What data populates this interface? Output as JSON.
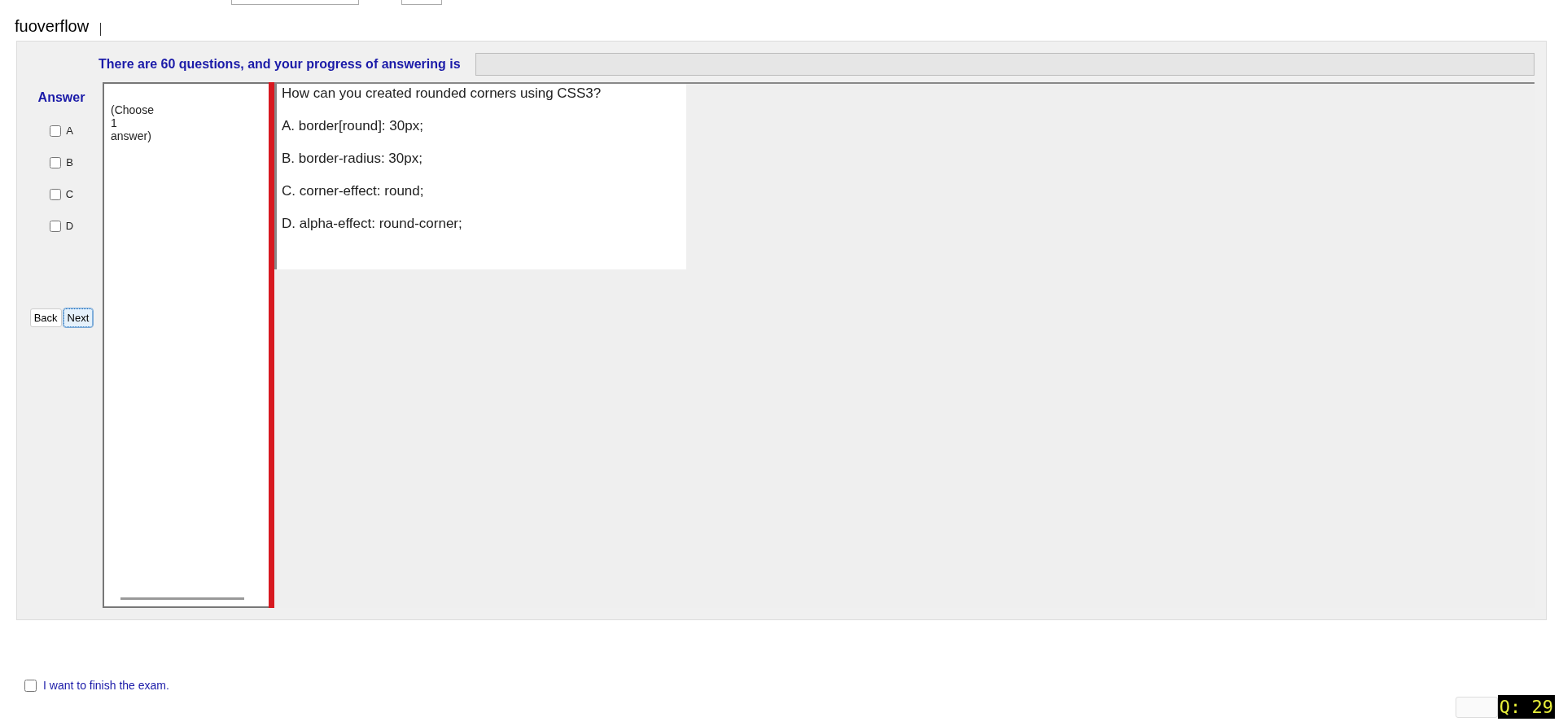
{
  "brand": "fuoverflow",
  "progress": {
    "label": "There are 60 questions, and your progress of answering is",
    "level": 0
  },
  "answer": {
    "heading": "Answer",
    "options": [
      {
        "letter": "A",
        "checked": false
      },
      {
        "letter": "B",
        "checked": false
      },
      {
        "letter": "C",
        "checked": false
      },
      {
        "letter": "D",
        "checked": false
      }
    ]
  },
  "buttons": [
    {
      "label": "Back",
      "focused": false
    },
    {
      "label": "Next",
      "focused": true
    }
  ],
  "instruction": [
    "(Choose",
    "1",
    "answer)"
  ],
  "question": {
    "text": "How can you created rounded corners using CSS3?",
    "choices": [
      "A.  border[round]: 30px;",
      "B.  border-radius: 30px;",
      "C.  corner-effect: round;",
      "D.  alpha-effect: round-corner;"
    ]
  },
  "finish": {
    "label": "I want to finish the exam.",
    "checked": false
  },
  "question_badge": "Q: 29"
}
